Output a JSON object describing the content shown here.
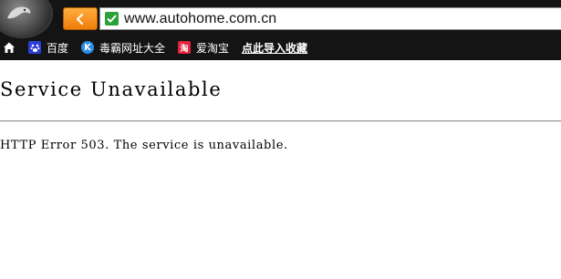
{
  "browser": {
    "url": "www.autohome.com.cn",
    "icons": {
      "logo": "cheetah-logo-icon",
      "back": "back-arrow-icon",
      "secure": "checkmark-icon",
      "home": "home-icon"
    },
    "colors": {
      "chrome_background": "#141414",
      "back_button": "#f39121",
      "secure_badge": "#2ea03a"
    }
  },
  "bookmarks": [
    {
      "label": "百度",
      "icon": "baidu-paw-icon"
    },
    {
      "label": "毒霸网址大全",
      "icon": "duba-k-icon"
    },
    {
      "label": "爱淘宝",
      "icon": "taobao-icon"
    },
    {
      "label": "点此导入收藏",
      "icon": ""
    }
  ],
  "page": {
    "title": "Service Unavailable",
    "message": "HTTP Error 503. The service is unavailable."
  }
}
